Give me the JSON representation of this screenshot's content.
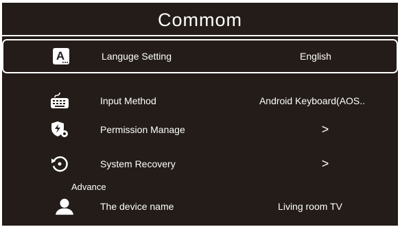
{
  "header": {
    "title": "Commom"
  },
  "settings": {
    "items": [
      {
        "icon": "language-icon",
        "label": "Languge Setting",
        "value": "English",
        "selected": true
      },
      {
        "icon": "keyboard-icon",
        "label": "Input Method",
        "value": "Android Keyboard(AOS.."
      },
      {
        "icon": "permission-shield-icon",
        "label": "Permission Manage",
        "value": ">"
      },
      {
        "icon": "recovery-icon",
        "label": "System Recovery",
        "value": ">"
      }
    ],
    "advance_label": "Advance",
    "advance_items": [
      {
        "icon": "user-icon",
        "label": "The device name",
        "value": "Living room TV"
      }
    ]
  },
  "colors": {
    "background": "#231c18",
    "text": "#ffffff",
    "highlight_border": "#ffffff"
  }
}
